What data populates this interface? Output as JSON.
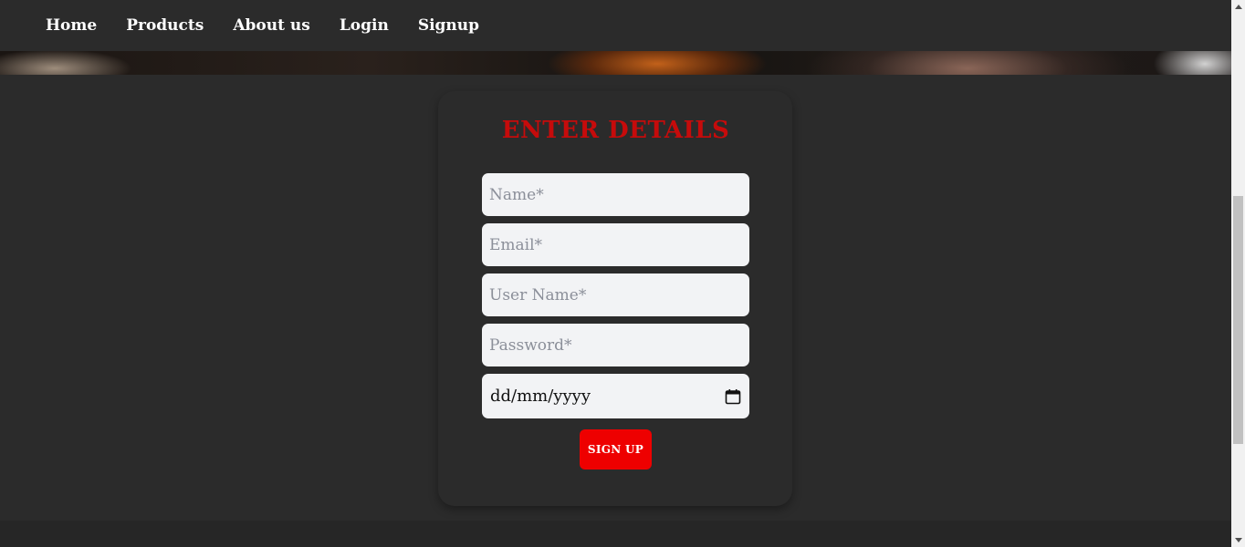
{
  "nav": {
    "items": [
      {
        "label": "Home"
      },
      {
        "label": "Products"
      },
      {
        "label": "About us"
      },
      {
        "label": "Login"
      },
      {
        "label": "Signup"
      }
    ]
  },
  "form": {
    "title": "ENTER DETAILS",
    "name_placeholder": "Name*",
    "email_placeholder": "Email*",
    "username_placeholder": "User Name*",
    "password_placeholder": "Password*",
    "date_placeholder": "dd/mm/yyyy",
    "submit_label": "SIGN UP"
  },
  "colors": {
    "background": "#2b2b2b",
    "title_accent": "#c60b0b",
    "button": "#ee0000",
    "input_bg": "#f2f3f5"
  },
  "icons": {
    "date_picker": "calendar-icon"
  }
}
